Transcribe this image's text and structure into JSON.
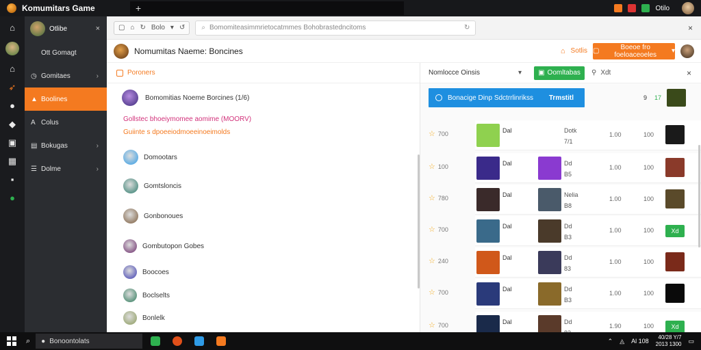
{
  "window": {
    "app_title": "Komumitars Game",
    "new_tab_label": "+",
    "status_label": "Otilo",
    "colors": {
      "accent": "#f47a20",
      "blue": "#1e8fe0",
      "green": "#2eb04f",
      "pink": "#d2317a"
    }
  },
  "rail": {
    "icons": [
      "home-icon",
      "avatar",
      "home-icon",
      "rocket-icon",
      "circle-icon",
      "shield-icon",
      "image-icon",
      "grid-icon",
      "info-icon",
      "status-dot-icon"
    ]
  },
  "sidebar": {
    "head_label": "Otlibe",
    "close_label": "×",
    "items": [
      {
        "label": "Ott Gomagt",
        "icon": "",
        "chevron": false,
        "active": false
      },
      {
        "label": "Gomitaes",
        "icon": "◷",
        "chevron": true,
        "active": false
      },
      {
        "label": "Boolines",
        "icon": "▲",
        "chevron": false,
        "active": true
      },
      {
        "label": "Colus",
        "icon": "A",
        "chevron": false,
        "active": false
      },
      {
        "label": "Bokugas",
        "icon": "▤",
        "chevron": true,
        "active": false
      },
      {
        "label": "Dolme",
        "icon": "☰",
        "chevron": true,
        "active": false
      }
    ]
  },
  "toolbar": {
    "nav_label": "Bolo",
    "address": "Bomomiteasimmrietocatmmes Bohobrastedncitoms",
    "close_label": "×"
  },
  "page_header": {
    "title": "Nomumitas Naeme: Boncines",
    "link_label": "Sotlis",
    "button_label": "Boeoe fro foeloaceoeles",
    "button_caret": "▾"
  },
  "left_panel": {
    "section_label": "Poroners",
    "featured_text": "Bomomitias Noeme Borcines (1/6)",
    "pink_text": "Gollstec bhoeiymomee aomime (MOORV)",
    "orange_text": "Guiinte s dpoeeiodmoeeinoeimolds",
    "items": [
      {
        "label": "Domootars",
        "color": "#2f9be6"
      },
      {
        "label": "Gomtsloncis",
        "color": "#2b7a6b"
      },
      {
        "label": "Gonbonoues",
        "color": "#7a5a3a"
      },
      {
        "label": "Gombutopon Gobes",
        "color": "#6a2a6a"
      },
      {
        "label": "Boocoes",
        "color": "#3a3ab0"
      },
      {
        "label": "Boclselts",
        "color": "#2d7a5a"
      },
      {
        "label": "Bonlelk",
        "color": "#8a9a5a"
      }
    ]
  },
  "right_panel": {
    "select_label": "Nomlocce Oinsis",
    "select_caret": "▾",
    "green_button": "Oomltabas",
    "search_label": "Xdt",
    "close_label": "×",
    "banner_text": "Bonacige Dinp Sdctrrlinrikss",
    "banner_action": "Trmstitl",
    "banner_num_1": "9",
    "banner_num_2": "17",
    "rows": [
      {
        "rank": "700",
        "tag1": "Dal",
        "sub1": "Dotk",
        "sub2": "7/1",
        "num1": "1.00",
        "num2": "100",
        "pill": "",
        "thumb1": "#8fd14f",
        "thumb2": "",
        "thumb3": "#1a1a1a"
      },
      {
        "rank": "100",
        "tag1": "Dal",
        "sub1": "Dd",
        "sub2": "B5",
        "num1": "1.00",
        "num2": "100",
        "pill": "",
        "thumb1": "#3a2a8a",
        "thumb2": "#8a3ad0",
        "thumb3": "#8a3a2a"
      },
      {
        "rank": "780",
        "tag1": "Dal",
        "sub1": "Nelia",
        "sub2": "B8",
        "num1": "1.00",
        "num2": "100",
        "pill": "",
        "thumb1": "#3a2a2a",
        "thumb2": "#4a5a6a",
        "thumb3": "#5a4a2a"
      },
      {
        "rank": "700",
        "tag1": "Dal",
        "sub1": "Dd",
        "sub2": "B3",
        "num1": "1.00",
        "num2": "100",
        "pill": "Xd",
        "thumb1": "#3a6a8a",
        "thumb2": "#4a3a2a",
        "thumb3": ""
      },
      {
        "rank": "240",
        "tag1": "Dal",
        "sub1": "Dd",
        "sub2": "83",
        "num1": "1.00",
        "num2": "100",
        "pill": "",
        "thumb1": "#d0581a",
        "thumb2": "#3a3a5a",
        "thumb3": "#7a2a1a"
      },
      {
        "rank": "700",
        "tag1": "Dal",
        "sub1": "Dd",
        "sub2": "B3",
        "num1": "1.00",
        "num2": "100",
        "pill": "",
        "thumb1": "#2a3a7a",
        "thumb2": "#8a6a2a",
        "thumb3": "#0a0a0a"
      },
      {
        "rank": "700",
        "tag1": "Dal",
        "sub1": "Dd",
        "sub2": "83",
        "num1": "1.90",
        "num2": "100",
        "pill": "Xd",
        "thumb1": "#1a2a4a",
        "thumb2": "#5a3a2a",
        "thumb3": ""
      }
    ]
  },
  "taskbar": {
    "search_text": "Bonoontolats",
    "tray_text": "Al 108",
    "clock_time": "40/28 Y/7",
    "clock_date": "2013 1300"
  }
}
